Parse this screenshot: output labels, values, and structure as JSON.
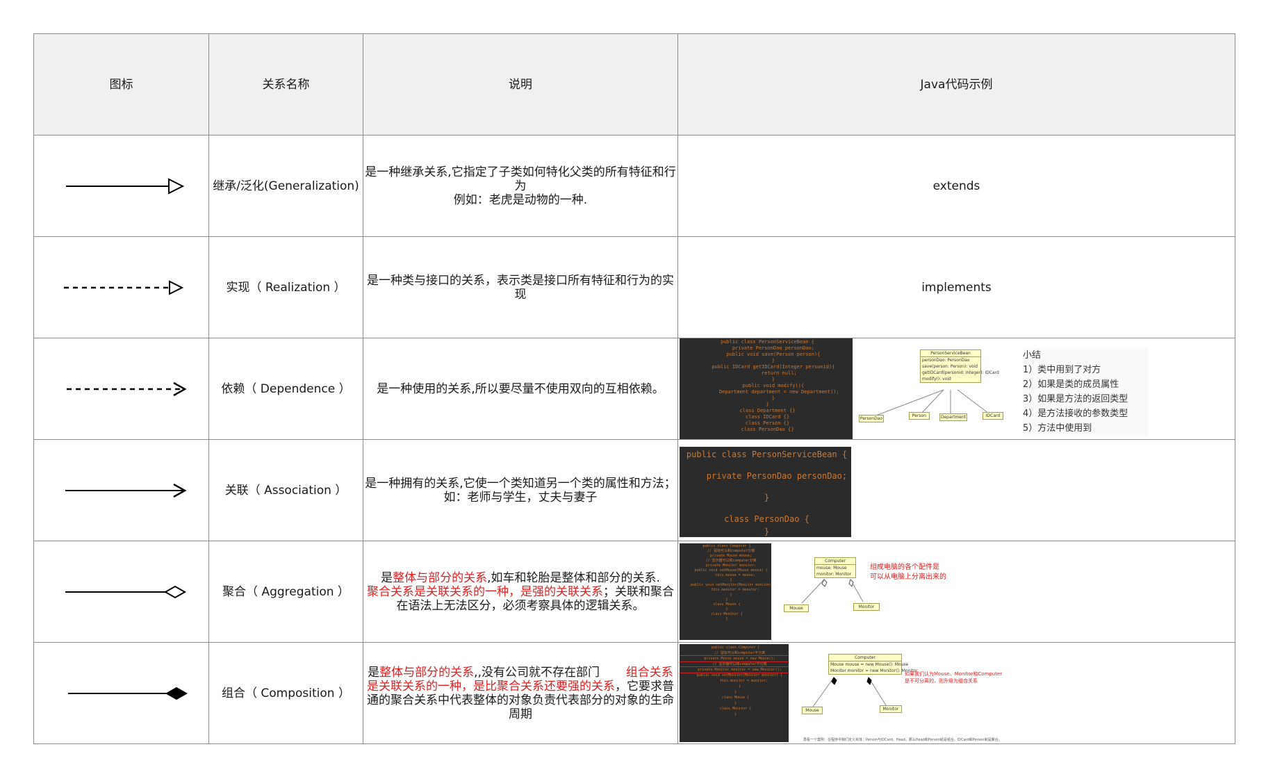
{
  "headers": {
    "icon": "图标",
    "name": "关系名称",
    "desc": "说明",
    "example": "Java代码示例"
  },
  "rows": [
    {
      "name": "继承/泛化(Generalization)",
      "desc": [
        "是一种继承关系,它指定了子类如何特化父类的所有特征和行为",
        "例如：老虎是动物的一种."
      ],
      "example": "extends"
    },
    {
      "name": "实现（ Realization ）",
      "desc": [
        "是一种类与接口的关系，表示类是接口所有特征和行为的实现"
      ],
      "example": "implements"
    },
    {
      "name": "依赖（ Dependence ）",
      "desc": [
        "是一种使用的关系,所以要尽量不使用双向的互相依赖。"
      ],
      "example_code": [
        "public class PersonServiceBean {",
        "    private PersonDao personDao;",
        "    public void save(Person person){",
        "    }",
        "    public IDCard getIDCard(Integer personid){",
        "        return null;",
        "    }",
        "    public void modify(){",
        "        Department department = new Department();",
        "    }",
        "}",
        "class Department {}",
        "class IDCard {}",
        "class Person {}",
        "class PersonDao {}"
      ],
      "example_diagram": {
        "main_title": "PersonServiceBean",
        "main_rows": [
          "personDao: PersonDao",
          "save(person: Person): void",
          "getIDCard(personid: Integer): IDCard",
          "modify(): void"
        ],
        "leaves": [
          "PersonDao",
          "Person",
          "Department",
          "IDCard"
        ]
      },
      "summary_title": "小结",
      "summary_items": [
        "1）类中用到了对方",
        "2）如果是类的成员属性",
        "3）如果是方法的返回类型",
        "4）是方法接收的参数类型",
        "5）方法中使用到"
      ]
    },
    {
      "name": "关联（ Association ）",
      "desc": [
        "是一种拥有的关系,它使一个类知道另一个类的属性和方法；",
        "如：老师与学生，丈夫与妻子"
      ],
      "example_code": [
        "public class PersonServiceBean {",
        "",
        "    private PersonDao personDao;",
        "",
        "}",
        "",
        "class PersonDao {",
        "}"
      ]
    },
    {
      "name": "聚合（ Aggregation ）",
      "desc_parts": [
        {
          "text": "是",
          "red": false
        },
        {
          "text": "整体与部分的关系",
          "red": true
        },
        {
          "text": ",如车和轮胎是整体和部分的关系.",
          "red": false
        },
        {
          "text": "聚合关系是关联关系的一种，是强的关联关系",
          "red": true
        },
        {
          "text": "；关联和聚合在语法上无法区分，必须考察具体的逻辑关系。",
          "red": false
        }
      ],
      "example_code": [
        "public class Computer {",
        "    // 鼠标可以和computer分离",
        "    private Mouse mouse;",
        "    // 显示器可以和computer分离",
        "    private Monitor monitor;",
        "",
        "    public void setMouse(Mouse mouse) {",
        "        this.mouse = mouse;",
        "    }",
        "    public void setMonitor(Monitor monitor) {",
        "        this.monitor = monitor;",
        "    }",
        "}",
        "",
        "class Mouse {",
        "}",
        "",
        "class Monitor {",
        "}"
      ],
      "example_diagram": {
        "main_title": "Computer",
        "main_rows": [
          "mouse: Mouse",
          "monitor: Monitor"
        ],
        "leaves": [
          "Mouse",
          "Monitor"
        ]
      },
      "note": [
        "组成电脑的各个配件是",
        "可以从电脑上分离出来的"
      ]
    },
    {
      "name": "组合（ Composition ）",
      "desc_parts": [
        {
          "text": "是",
          "red": false
        },
        {
          "text": "整体与部分的关系",
          "red": true
        },
        {
          "text": ",,没有公司就不存在部门       ",
          "red": false
        },
        {
          "text": "组合关系是关联关系的一种，是比聚合关系还要强的关系",
          "red": true
        },
        {
          "text": "，它要求普通的聚合关系中代表整体的对象负责代表部分的对象的生命周期",
          "red": false
        }
      ],
      "example_code": [
        "public class Computer {",
        "    // 鼠标可以和computer不分离",
        "    private Mouse mouse = new Mouse();",
        "    // 显示器可以和computer不分离",
        "    private Monitor monitor = new Monitor();",
        "",
        "    public void setMonitor(Monitor monitor) {",
        "        this.monitor = monitor;",
        "    }",
        "}",
        "",
        "class Mouse {",
        "}",
        "",
        "class Monitor {",
        "}"
      ],
      "example_diagram": {
        "main_title": "Computer",
        "main_rows": [
          "Mouse mouse = new Mouse(): Mouse",
          "Monitor monitor = new Monitor(): Monitor"
        ],
        "leaves": [
          "Mouse",
          "Monitor"
        ]
      },
      "note": [
        "如果我们认为Mouse、Monitor和Computer",
        "是不可分离的，则升级为组合关系"
      ],
      "caption": "再看一个案例：在程序中我们定义实体：Person与IDCard、Head，那么Head和Person就是组合，IDCard和Person就是聚合。"
    }
  ]
}
